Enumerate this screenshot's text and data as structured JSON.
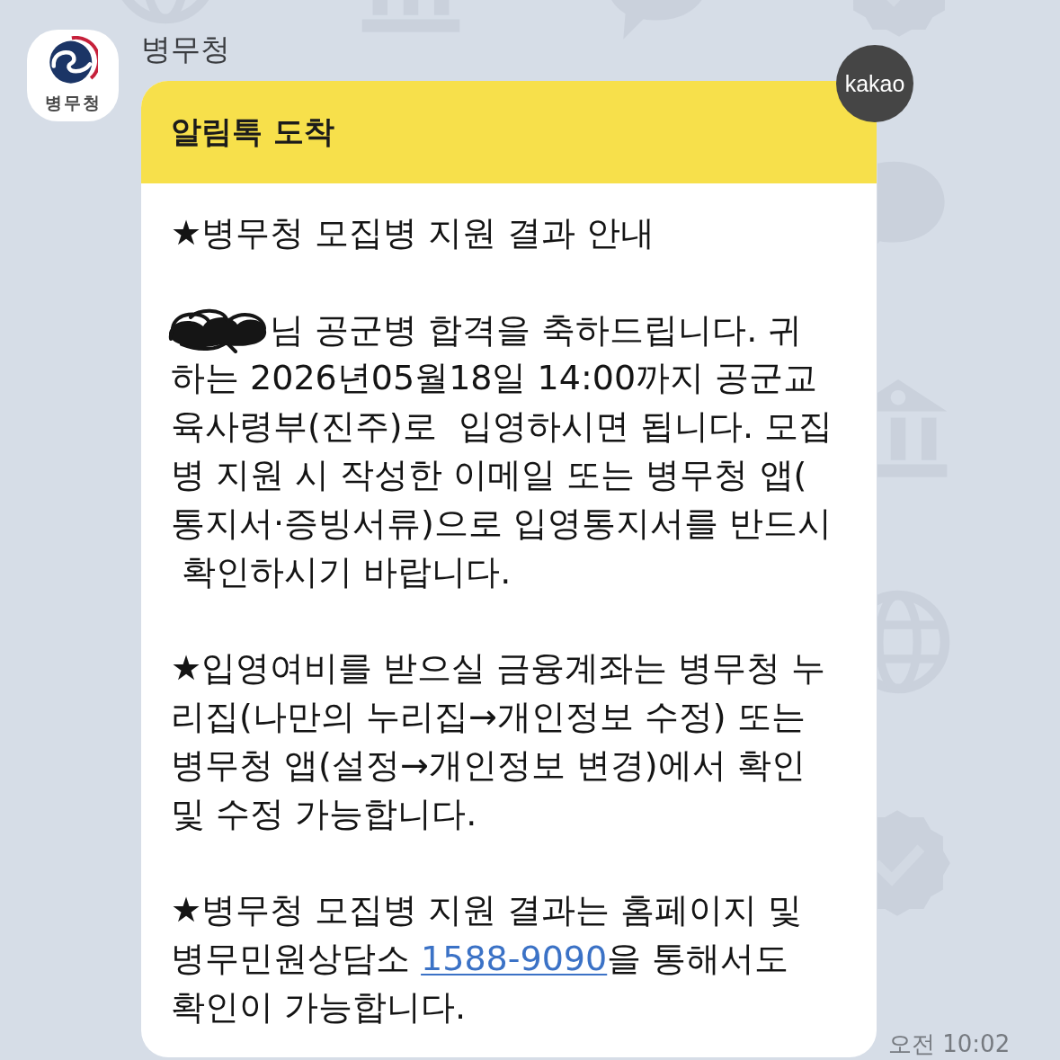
{
  "sender": {
    "avatar_label": "병무청",
    "name": "병무청"
  },
  "message": {
    "header": "알림톡 도착",
    "badge": "kakao",
    "paragraphs": [
      {
        "redacted_start": false,
        "segments": [
          {
            "kind": "text",
            "text": "★병무청 모집병 지원 결과 안내"
          }
        ]
      },
      {
        "redacted_start": true,
        "segments": [
          {
            "kind": "text",
            "text": "님 공군병 합격을 축하드립니다. 귀\n하는 2026년05월18일 14:00까지 공군교\n육사령부(진주)로  입영하시면 됩니다. 모집\n병 지원 시 작성한 이메일 또는 병무청 앱(\n통지서·증빙서류)으로 입영통지서를 반드시\n 확인하시기 바랍니다."
          }
        ]
      },
      {
        "redacted_start": false,
        "segments": [
          {
            "kind": "text",
            "text": "★입영여비를 받으실 금융계좌는 병무청 누\n리집(나만의 누리집→개인정보 수정) 또는\n병무청 앱(설정→개인정보 변경)에서 확인\n및 수정 가능합니다."
          }
        ]
      },
      {
        "redacted_start": false,
        "segments": [
          {
            "kind": "text",
            "text": "★병무청 모집병 지원 결과는 홈페이지 및\n병무민원상담소 "
          },
          {
            "kind": "link",
            "text": "1588-9090"
          },
          {
            "kind": "text",
            "text": "을 통해서도\n확인이 가능합니다."
          }
        ]
      }
    ]
  },
  "time": "오전 10:02"
}
